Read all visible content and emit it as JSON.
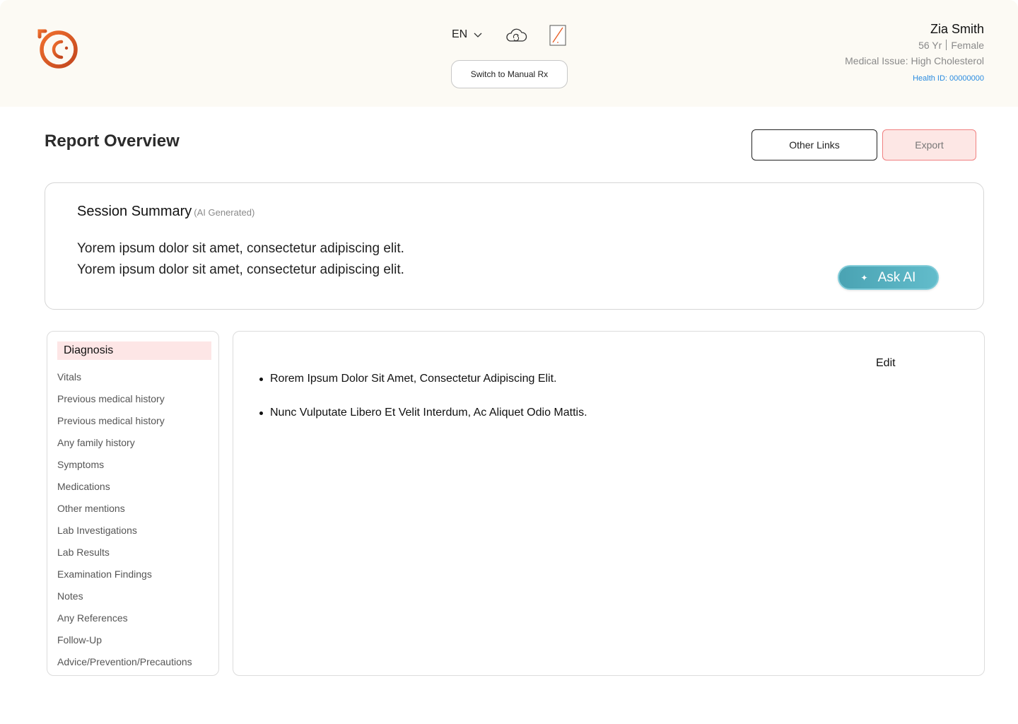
{
  "header": {
    "language": "EN",
    "switch_button": "Switch to Manual Rx",
    "icons": [
      "logo-icon",
      "chevron-down-icon",
      "cloud-sync-icon",
      "notepad-icon"
    ]
  },
  "patient": {
    "name": "Zia Smith",
    "age": "56 Yr",
    "gender": "Female",
    "medical_issue": "Medical Issue: High Cholesterol",
    "health_id": "Health ID: 00000000"
  },
  "page": {
    "title": "Report Overview",
    "other_links": "Other Links",
    "export": "Export"
  },
  "summary": {
    "title": "Session Summary",
    "tag": "(AI Generated)",
    "line1": "Yorem ipsum dolor sit amet, consectetur adipiscing elit.",
    "line2": "Yorem ipsum dolor sit amet, consectetur adipiscing elit.",
    "ask_ai": "Ask AI"
  },
  "sidenav": {
    "active": "Diagnosis",
    "items": [
      "Vitals",
      "Previous medical history",
      "Previous medical history",
      "Any family history",
      "Symptoms",
      "Medications",
      "Other mentions",
      "Lab Investigations",
      "Lab Results",
      "Examination Findings",
      "Notes",
      "Any References",
      "Follow-Up",
      "Advice/Prevention/Precautions"
    ]
  },
  "content": {
    "edit": "Edit",
    "bullets": [
      "Rorem Ipsum Dolor Sit Amet, Consectetur Adipiscing Elit.",
      "Nunc Vulputate Libero Et Velit Interdum, Ac Aliquet Odio Mattis."
    ]
  },
  "colors": {
    "header_bg": "#fcfaf4",
    "brand_orange": "#e8622a",
    "active_nav_bg": "#fde6e6",
    "export_bg": "#fde7e5",
    "ask_ai_teal": "#4aa3b3",
    "link_blue": "#2a8be0"
  }
}
